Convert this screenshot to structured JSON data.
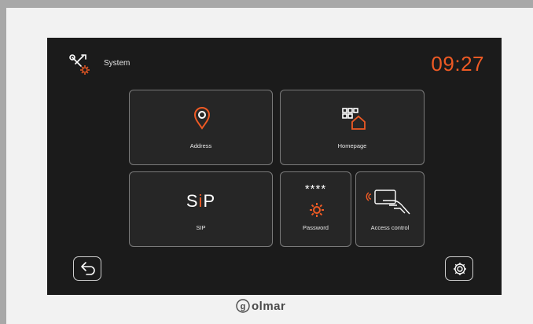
{
  "header": {
    "title": "System",
    "time": "09:27",
    "icon": "system-tools-icon"
  },
  "tiles": [
    {
      "id": "address",
      "label": "Address",
      "icon": "location-pin-icon"
    },
    {
      "id": "homepage",
      "label": "Homepage",
      "icon": "home-grid-icon"
    },
    {
      "id": "sip",
      "label": "SIP",
      "icon": "sip-logo",
      "logo_text": {
        "s": "S",
        "i": "i",
        "p": "P"
      }
    },
    {
      "id": "password",
      "label": "Password",
      "icon": "password-gear-icon",
      "stars": "****"
    },
    {
      "id": "access-control",
      "label": "Access control",
      "icon": "card-reader-icon"
    }
  ],
  "footer": {
    "back_icon": "back-arrow-icon",
    "settings_icon": "settings-gear-icon",
    "brand": "olmar",
    "brand_initial": "g"
  },
  "colors": {
    "accent": "#ee5a24",
    "screen_bg": "#1b1b1b",
    "tile_bg": "#262626",
    "tile_border": "#7a7a7a"
  }
}
